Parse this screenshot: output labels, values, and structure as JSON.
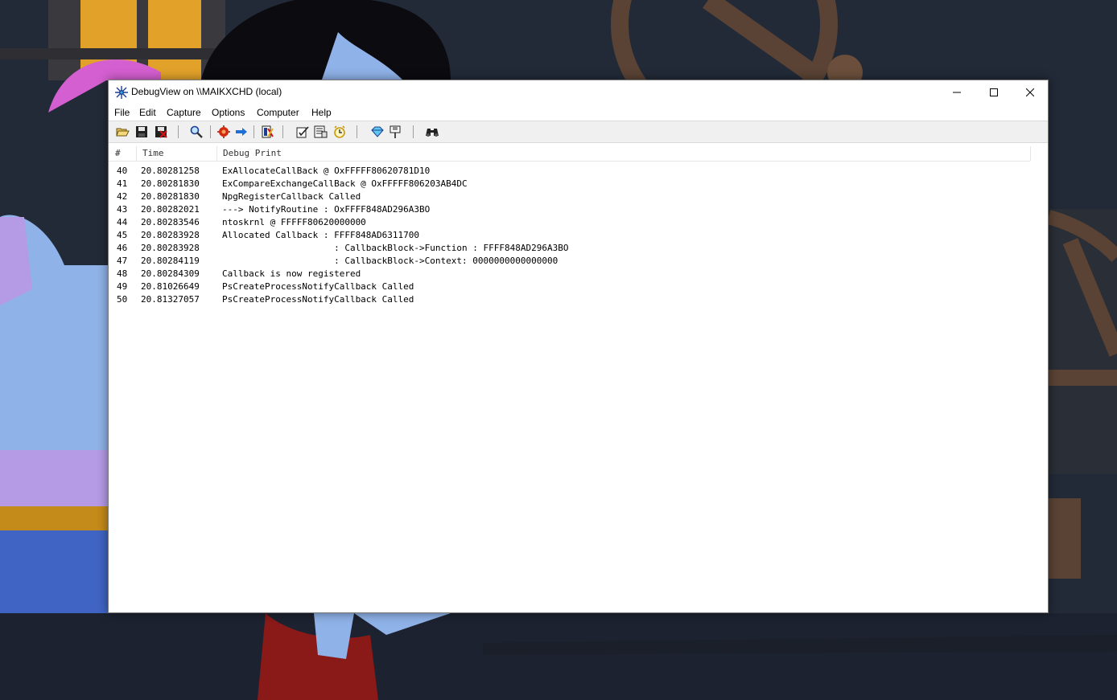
{
  "window": {
    "title": "DebugView on \\\\MAIKXCHD (local)"
  },
  "menu": [
    "File",
    "Edit",
    "Capture",
    "Options",
    "Computer",
    "Help"
  ],
  "toolbar": {
    "icons": [
      "open-icon",
      "save-icon",
      "save-red-icon",
      "find-icon",
      "capture-icon",
      "autoscroll-icon",
      "clear-icon",
      "highlight-icon",
      "filter-icon",
      "clock-icon",
      "diamond-icon",
      "pin-icon",
      "binoculars-icon"
    ]
  },
  "columns": {
    "num": "#",
    "time": "Time",
    "print": "Debug Print"
  },
  "rows": [
    {
      "num": "40",
      "time": "20.80281258",
      "msg": "ExAllocateCallBack @ OxFFFFF80620781D10"
    },
    {
      "num": "41",
      "time": "20.80281830",
      "msg": "ExCompareExchangeCallBack @ OxFFFFF806203AB4DC"
    },
    {
      "num": "42",
      "time": "20.80281830",
      "msg": "NpgRegisterCallback Called"
    },
    {
      "num": "43",
      "time": "20.80282021",
      "msg": "---> NotifyRoutine : OxFFFF848AD296A3BO"
    },
    {
      "num": "44",
      "time": "20.80283546",
      "msg": "ntoskrnl @ FFFFF80620000000"
    },
    {
      "num": "45",
      "time": "20.80283928",
      "msg": "Allocated Callback : FFFF848AD6311700"
    },
    {
      "num": "46",
      "time": "20.80283928",
      "msg": "                     : CallbackBlock->Function : FFFF848AD296A3BO"
    },
    {
      "num": "47",
      "time": "20.80284119",
      "msg": "                     : CallbackBlock->Context: 0000000000000000"
    },
    {
      "num": "48",
      "time": "20.80284309",
      "msg": "Callback is now registered"
    },
    {
      "num": "49",
      "time": "20.81026649",
      "msg": "PsCreateProcessNotifyCallback Called"
    },
    {
      "num": "50",
      "time": "20.81327057",
      "msg": "PsCreateProcessNotifyCallback Called"
    }
  ]
}
